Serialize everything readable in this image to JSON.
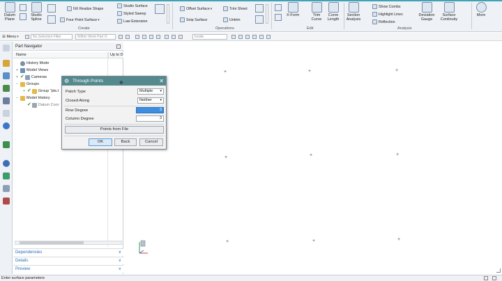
{
  "ribbon": {
    "datum_plane": "Datum\nPlane",
    "studio_spline": "Studio\nSpline",
    "nx_realize_shape": "NX Realize Shape",
    "four_point_surface": "Four Point Surface",
    "studio_surface": "Studio Surface",
    "styled_sweep": "Styled Sweep",
    "law_extension": "Law Extension",
    "create_label": "Create",
    "offset_surface": "Offset Surface",
    "trim_sheet": "Trim Sheet",
    "snip_surface": "Snip Surface",
    "untrim": "Untrim",
    "operations_label": "Operations",
    "x_form": "X-Form",
    "trim_curve": "Trim\nCurve",
    "curve_length": "Curve\nLength",
    "edit_label": "Edit",
    "section_analysis": "Section\nAnalysis",
    "show_combs": "Show Combs",
    "highlight_lines": "Highlight Lines",
    "reflection": "Reflection",
    "deviation_gauge": "Deviation\nGauge",
    "surface_continuity": "Surface\nContinuity",
    "analysis_label": "Analysis",
    "more": "More"
  },
  "selection_bar": {
    "menu": "Menu",
    "selection_filter": "No Selection Filter",
    "scope": "Within Work Part O",
    "snap": "Inside"
  },
  "navigator": {
    "title": "Part Navigator",
    "col_name": "Name",
    "col_uptodate": "Up to D",
    "tree": [
      {
        "label": "History Mode"
      },
      {
        "label": "Model Views"
      },
      {
        "label": "Cameras"
      },
      {
        "label": "Groups"
      },
      {
        "label": "Group \"pts.t"
      },
      {
        "label": "Model History"
      },
      {
        "label": "Datum Coor"
      }
    ],
    "panels": [
      "Dependencies",
      "Details",
      "Preview"
    ]
  },
  "dialog": {
    "title": "Through Points",
    "patch_type_label": "Patch Type",
    "patch_type_value": "Multiple",
    "closed_along_label": "Closed Along",
    "closed_along_value": "Neither",
    "row_degree_label": "Row Degree",
    "row_degree_value": "3",
    "column_degree_label": "Column Degree",
    "column_degree_value": "3",
    "points_from_file": "Points from File",
    "ok": "OK",
    "back": "Back",
    "cancel": "Cancel"
  },
  "status_text": "Enter surface parameters",
  "colors": {
    "dialog_title_bg": "#548a8e",
    "panel_text": "#2a6ebb",
    "accent_teal": "#3fa3b7"
  }
}
